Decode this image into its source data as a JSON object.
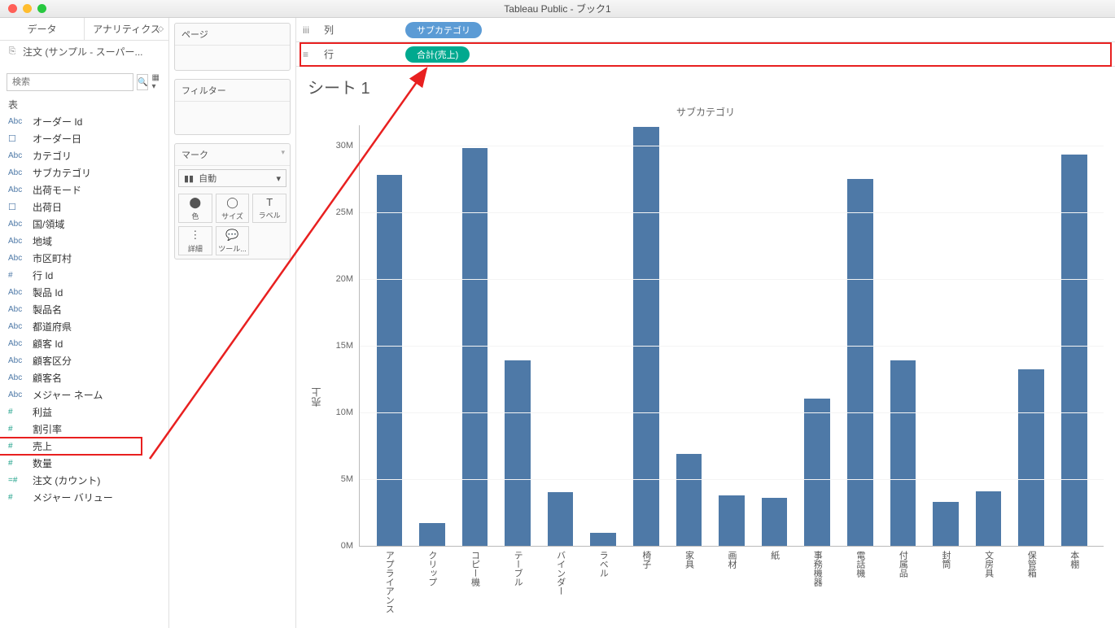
{
  "window": {
    "title": "Tableau Public - ブック1"
  },
  "sidebar": {
    "tabs": [
      "データ",
      "アナリティクス"
    ],
    "datasource": "注文 (サンプル - スーパー...",
    "search_placeholder": "検索",
    "table_label": "表",
    "fields_dimensions": [
      {
        "icon": "Abc",
        "label": "オーダー Id"
      },
      {
        "icon": "date",
        "label": "オーダー日"
      },
      {
        "icon": "Abc",
        "label": "カテゴリ"
      },
      {
        "icon": "Abc",
        "label": "サブカテゴリ"
      },
      {
        "icon": "Abc",
        "label": "出荷モード"
      },
      {
        "icon": "date",
        "label": "出荷日"
      },
      {
        "icon": "Abc",
        "label": "国/領域"
      },
      {
        "icon": "Abc",
        "label": "地域"
      },
      {
        "icon": "Abc",
        "label": "市区町村"
      },
      {
        "icon": "#",
        "label": "行 Id"
      },
      {
        "icon": "Abc",
        "label": "製品 Id"
      },
      {
        "icon": "Abc",
        "label": "製品名"
      },
      {
        "icon": "Abc",
        "label": "都道府県"
      },
      {
        "icon": "Abc",
        "label": "顧客 Id"
      },
      {
        "icon": "Abc",
        "label": "顧客区分"
      },
      {
        "icon": "Abc",
        "label": "顧客名"
      },
      {
        "icon": "Abc",
        "label": "メジャー ネーム"
      }
    ],
    "fields_measures": [
      {
        "icon": "#",
        "label": "利益"
      },
      {
        "icon": "#",
        "label": "割引率"
      },
      {
        "icon": "#",
        "label": "売上"
      },
      {
        "icon": "#",
        "label": "数量"
      },
      {
        "icon": "=#",
        "label": "注文 (カウント)"
      },
      {
        "icon": "#",
        "label": "メジャー バリュー"
      }
    ]
  },
  "shelves": {
    "pages": "ページ",
    "filters": "フィルター",
    "marks": {
      "title": "マーク",
      "type": "自動",
      "buttons": [
        {
          "icon": "⬤",
          "label": "色"
        },
        {
          "icon": "◯",
          "label": "サイズ"
        },
        {
          "icon": "T",
          "label": "ラベル"
        },
        {
          "icon": "⋮",
          "label": "詳細"
        },
        {
          "icon": "💬",
          "label": "ツール..."
        }
      ]
    }
  },
  "columns_shelf": {
    "label": "列",
    "pill": "サブカテゴリ"
  },
  "rows_shelf": {
    "label": "行",
    "pill": "合計(売上)"
  },
  "sheet_title": "シート 1",
  "chart_data": {
    "type": "bar",
    "title": "サブカテゴリ",
    "ylabel": "売上",
    "ylim": [
      0,
      31500000
    ],
    "y_ticks": [
      "0M",
      "5M",
      "10M",
      "15M",
      "20M",
      "25M",
      "30M"
    ],
    "categories": [
      "アプライアンス",
      "クリップ",
      "コピー機",
      "テーブル",
      "バインダー",
      "ラベル",
      "椅子",
      "家具",
      "画材",
      "紙",
      "事務機器",
      "電話機",
      "付属品",
      "封筒",
      "文房具",
      "保管箱",
      "本棚"
    ],
    "values": [
      27800000,
      1700000,
      29800000,
      13900000,
      4000000,
      1000000,
      31400000,
      6900000,
      3800000,
      3600000,
      11000000,
      27500000,
      13900000,
      3300000,
      4100000,
      13200000,
      29300000
    ]
  }
}
